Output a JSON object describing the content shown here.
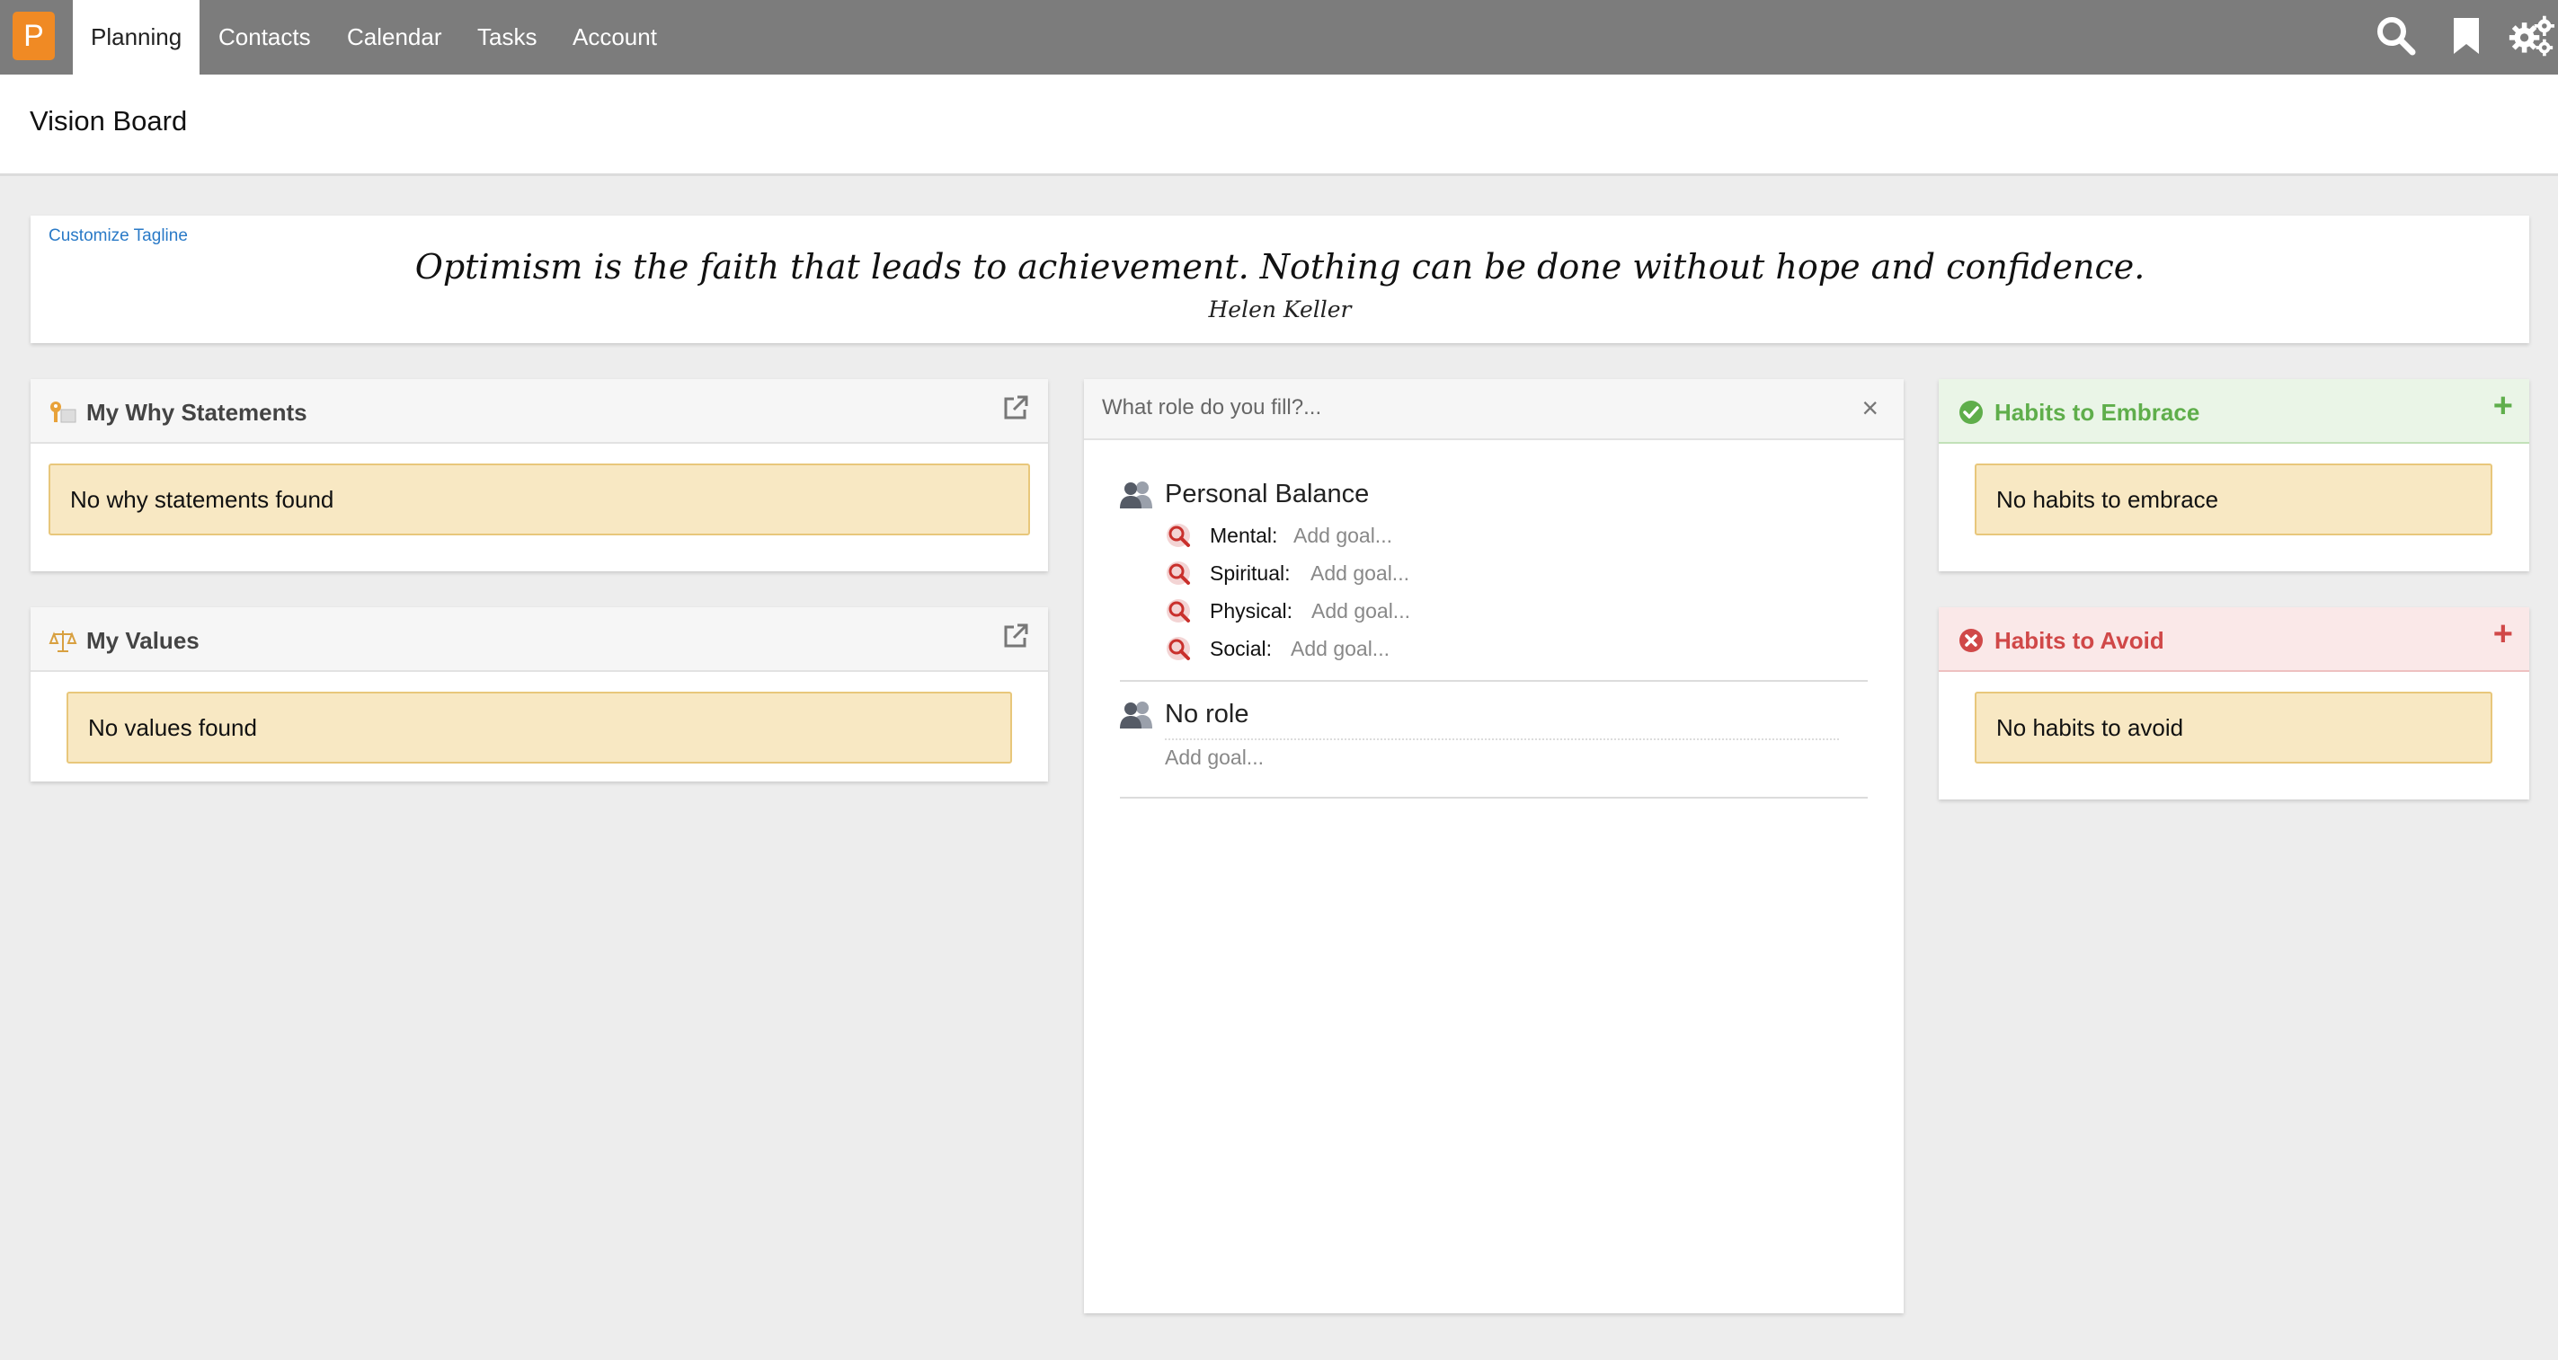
{
  "app": {
    "logo_letter": "P"
  },
  "nav": {
    "items": [
      {
        "label": "Planning",
        "active": true
      },
      {
        "label": "Contacts"
      },
      {
        "label": "Calendar"
      },
      {
        "label": "Tasks"
      },
      {
        "label": "Account"
      }
    ],
    "icons": [
      "search-icon",
      "bookmark-icon",
      "settings-gears-icon"
    ]
  },
  "page": {
    "title": "Vision Board"
  },
  "tagline": {
    "customize_label": "Customize Tagline",
    "quote": "Optimism is the faith that leads to achievement. Nothing can be done without hope and confidence.",
    "author": "Helen Keller"
  },
  "why_statements": {
    "title": "My Why Statements",
    "empty_text": "No why statements found"
  },
  "values": {
    "title": "My Values",
    "empty_text": "No values found"
  },
  "roles": {
    "placeholder": "What role do you fill?...",
    "close_glyph": "×",
    "groups": [
      {
        "title": "Personal Balance",
        "goals": [
          {
            "label": "Mental:",
            "add": "Add goal..."
          },
          {
            "label": "Spiritual:",
            "add": "Add goal..."
          },
          {
            "label": "Physical:",
            "add": "Add goal..."
          },
          {
            "label": "Social:",
            "add": "Add goal..."
          }
        ]
      },
      {
        "title": "No role",
        "add": "Add goal..."
      }
    ]
  },
  "habits_embrace": {
    "title": "Habits to Embrace",
    "empty_text": "No habits to embrace",
    "add_glyph": "+",
    "color": "#5fae4b"
  },
  "habits_avoid": {
    "title": "Habits to Avoid",
    "empty_text": "No habits to avoid",
    "add_glyph": "+",
    "color": "#d04848"
  }
}
